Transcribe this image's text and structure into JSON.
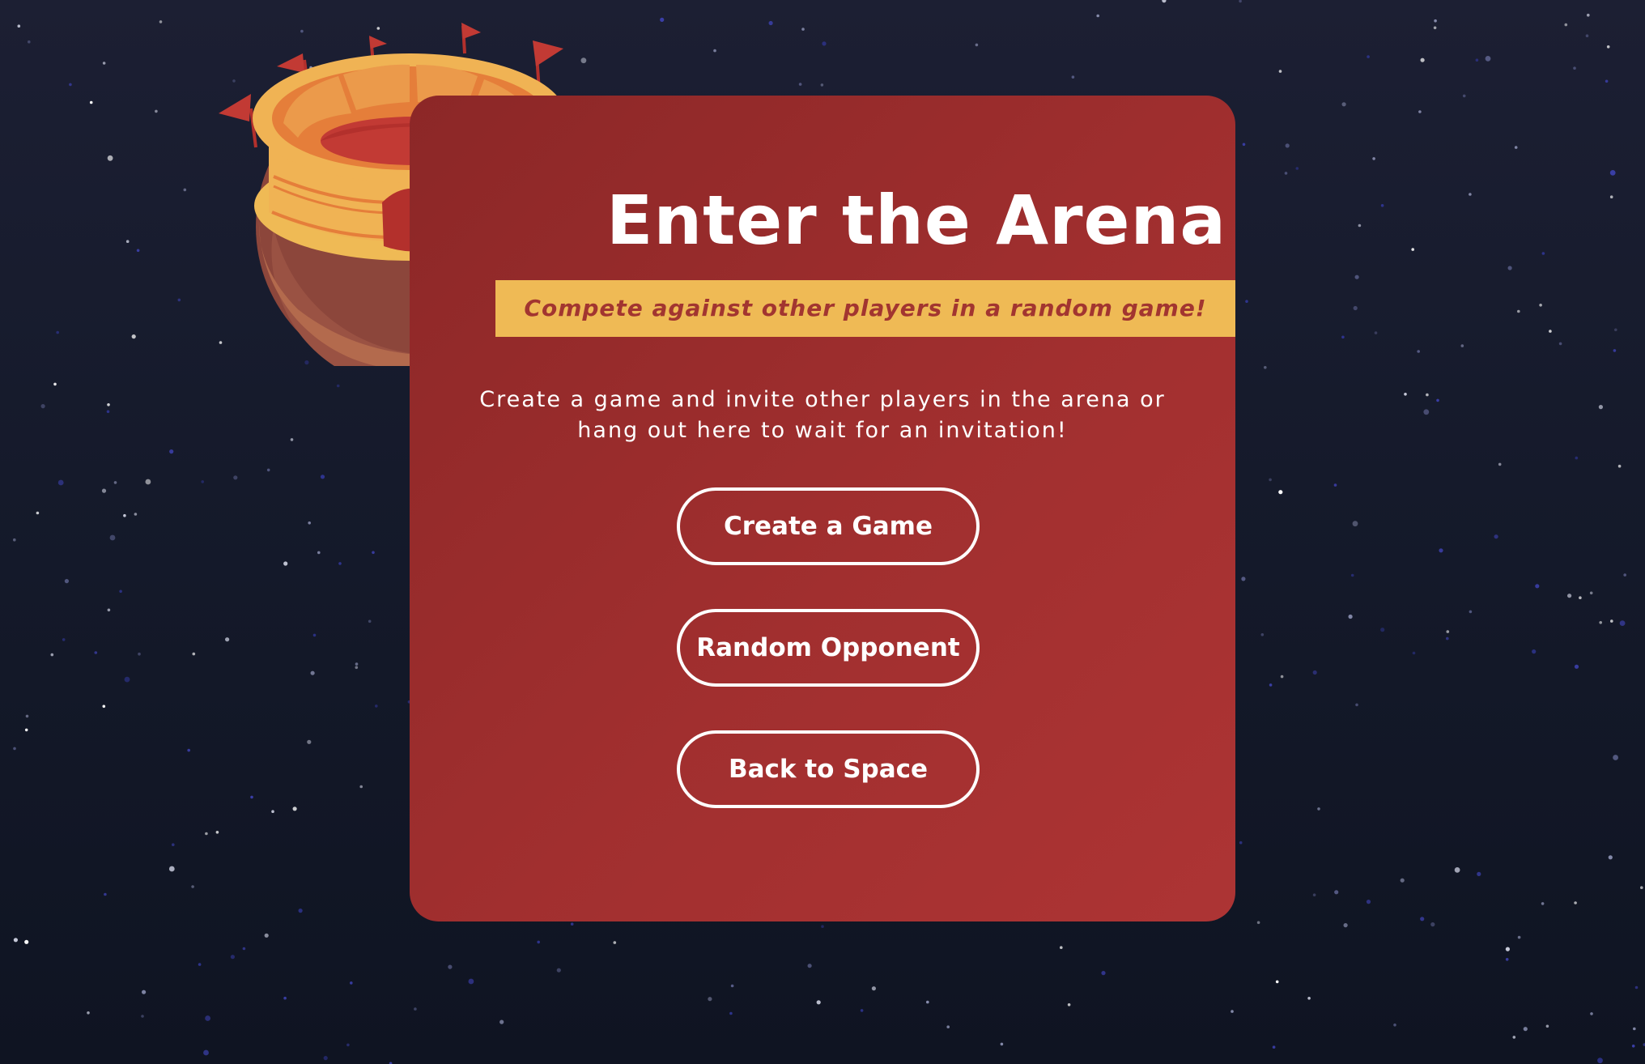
{
  "screen": {
    "title": "Enter the Arena",
    "subtitle": "Compete against other players in a random game!",
    "description_lines": [
      "Create a game and invite other players in the arena or",
      "hang out here to wait for an invitation!"
    ]
  },
  "buttons": {
    "create": "Create a Game",
    "random": "Random Opponent",
    "back": "Back to Space"
  },
  "colors": {
    "background": "#151a2b",
    "panel": "#a12f2f",
    "banner": "#efba55",
    "banner_text": "#a23530",
    "button_border": "#ffffff"
  },
  "icons": {
    "arena": "colosseum-planet-icon"
  }
}
